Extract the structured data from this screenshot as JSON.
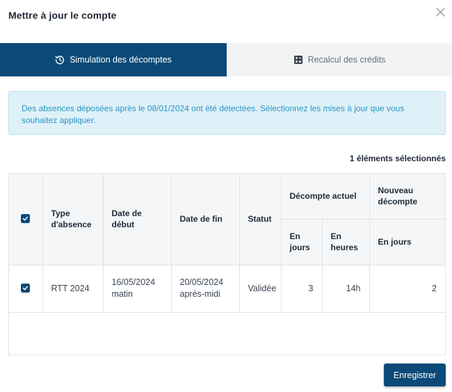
{
  "modal": {
    "title": "Mettre à jour le compte"
  },
  "tabs": [
    {
      "label": "Simulation des décomptes",
      "icon": "history-clock-icon",
      "active": true
    },
    {
      "label": "Recalcul des crédits",
      "icon": "calculator-icon",
      "active": false
    }
  ],
  "alert": {
    "text": "Des absences déposées après le 08/01/2024 ont été détectées. Sélectionnez les mises à jour que vous souhaitez appliquer."
  },
  "selection": {
    "count_label": "1 éléments sélectionnés"
  },
  "table": {
    "headers": {
      "type": "Type d'absence",
      "start": "Date de début",
      "end": "Date de fin",
      "status": "Statut",
      "current_group": "Décompte actuel",
      "new_group": "Nouveau décompte",
      "current_days": "En jours",
      "current_hours": "En heures",
      "new_days": "En jours"
    },
    "rows": [
      {
        "checked": true,
        "type": "RTT 2024",
        "start_date": "16/05/2024",
        "start_period": "matin",
        "end_date": "20/05/2024",
        "end_period": "après-midi",
        "status": "Validée",
        "current_days": "3",
        "current_hours": "14h",
        "new_days": "2"
      }
    ]
  },
  "footer": {
    "save_label": "Enregistrer"
  },
  "colors": {
    "primary": "#0b4a78",
    "alert_bg": "#dff1f8",
    "alert_text": "#2794c5"
  }
}
